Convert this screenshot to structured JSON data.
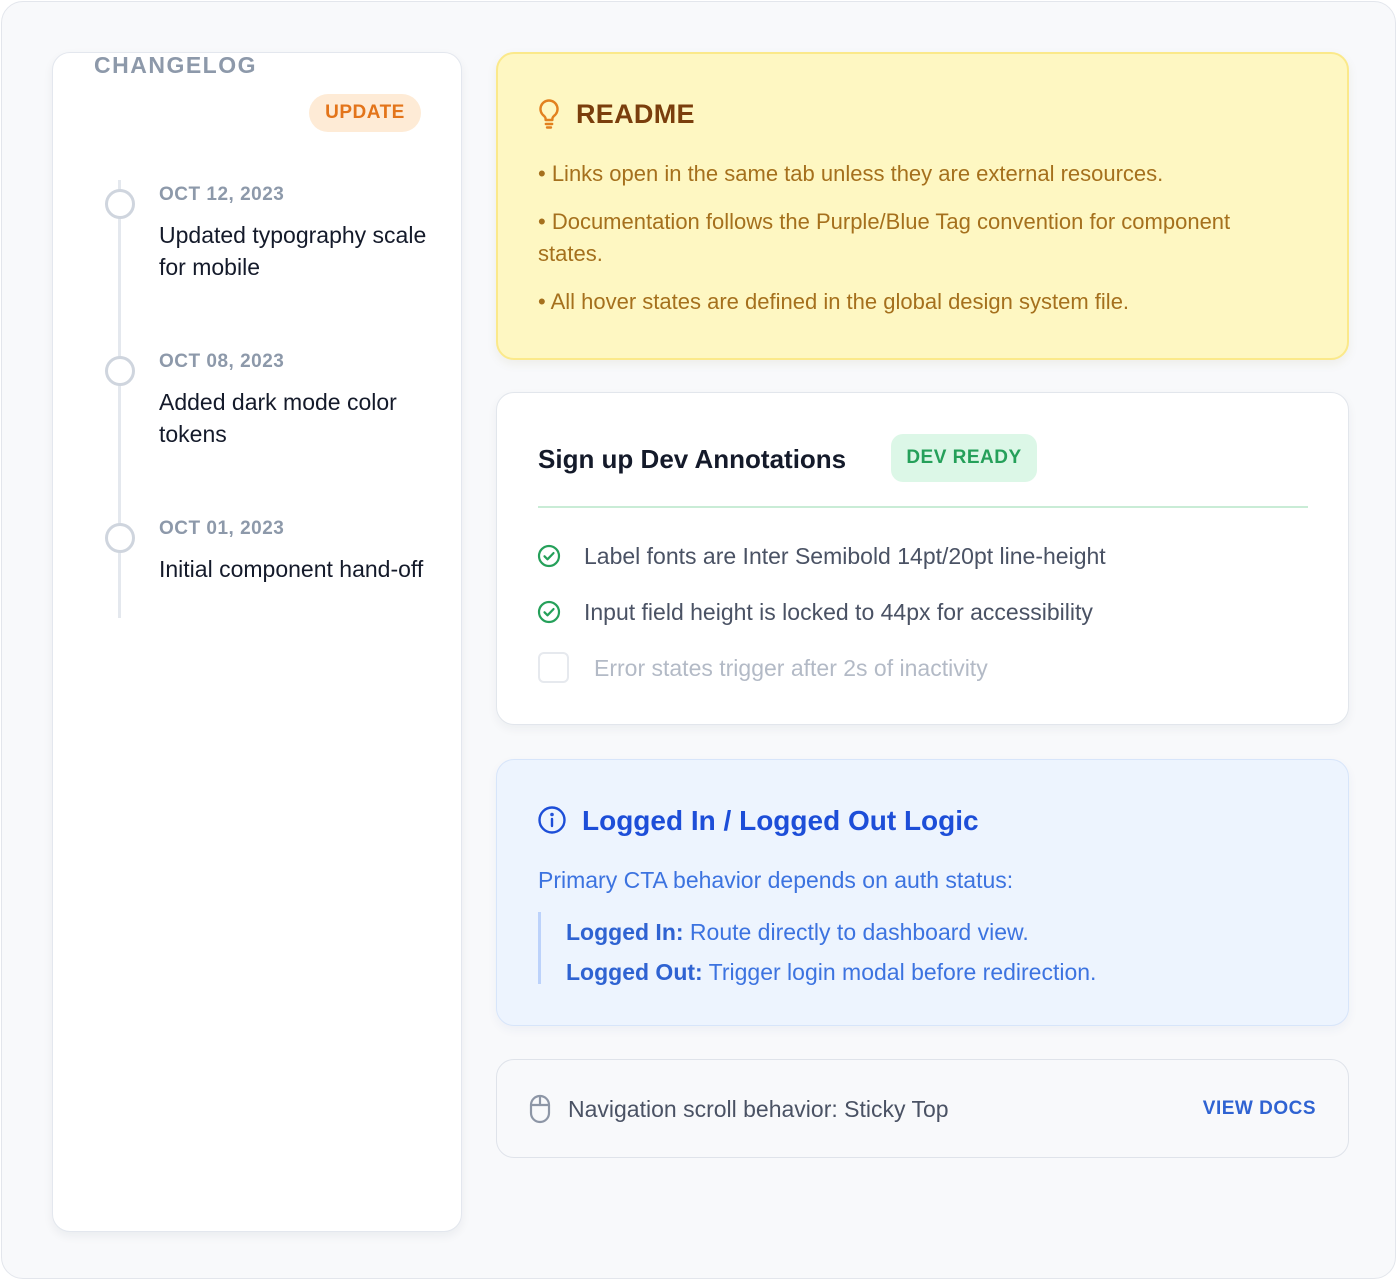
{
  "changelog": {
    "title": "CHANGELOG",
    "badge": "UPDATE",
    "entries": [
      {
        "date": "OCT 12, 2023",
        "text": "Updated typography scale for mobile"
      },
      {
        "date": "OCT 08, 2023",
        "text": "Added dark mode color tokens"
      },
      {
        "date": "OCT 01, 2023",
        "text": "Initial component hand-off"
      }
    ]
  },
  "readme": {
    "icon": "lightbulb-icon",
    "title": "README",
    "items": [
      "• Links open in the same tab unless they are external resources.",
      "• Documentation follows the Purple/Blue Tag convention for component states.",
      "• All hover states are defined in the global design system file."
    ]
  },
  "dev": {
    "title": "Sign up Dev Annotations",
    "badge": "DEV READY",
    "checks": [
      {
        "text": "Label fonts are Inter Semibold 14pt/20pt line-height",
        "checked": true
      },
      {
        "text": "Input field height is locked to 44px for accessibility",
        "checked": true
      },
      {
        "text": "Error states trigger after 2s of inactivity",
        "checked": false
      }
    ]
  },
  "logic": {
    "icon": "info-icon",
    "title": "Logged In / Logged Out Logic",
    "description": "Primary CTA behavior depends on auth status:",
    "rules": [
      {
        "label": "Logged In:",
        "text": " Route directly to dashboard view."
      },
      {
        "label": "Logged Out:",
        "text": " Trigger login modal before redirection."
      }
    ]
  },
  "footer": {
    "icon": "mouse-icon",
    "text": "Navigation scroll behavior: Sticky Top",
    "link": "VIEW DOCS"
  },
  "colors": {
    "update_badge": "#e3741a",
    "readme_title": "#7a3e0c",
    "dev_ready": "#25a05a",
    "logic_title": "#1d4ed8",
    "link": "#2f63d2"
  }
}
